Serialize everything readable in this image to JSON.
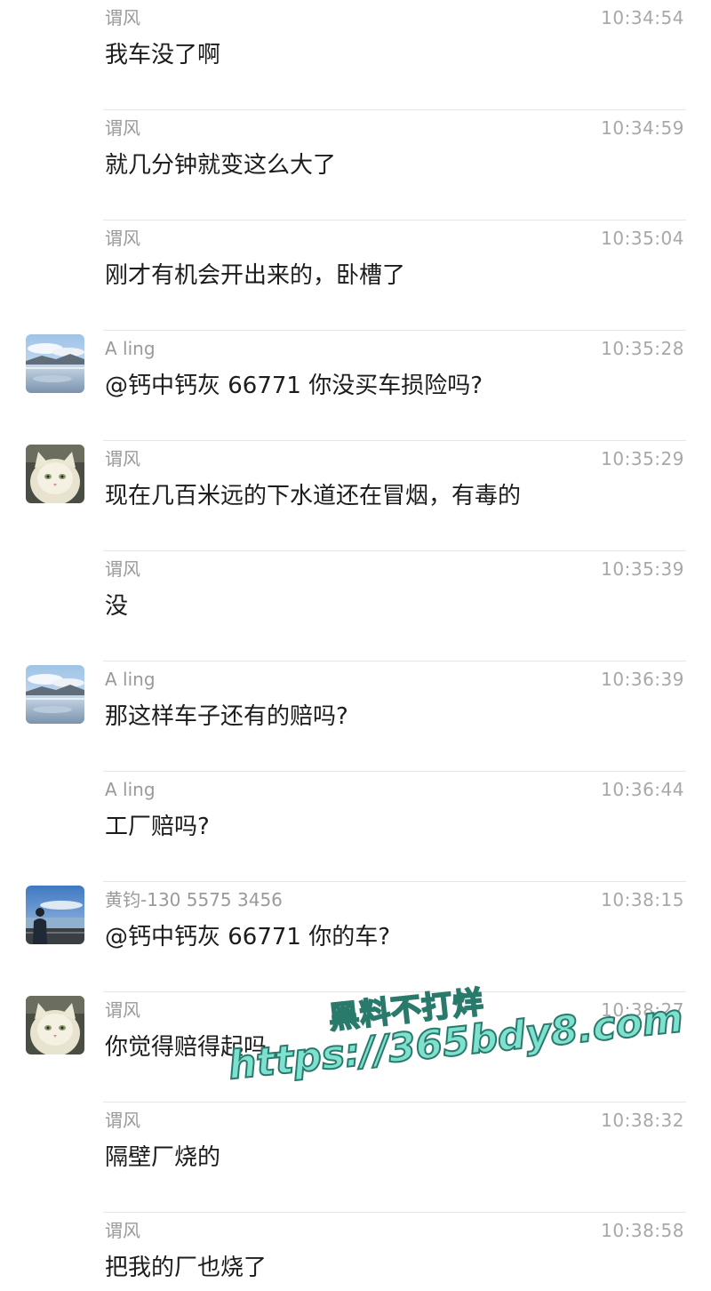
{
  "messages": [
    {
      "sender": "谓风",
      "time": "10:34:54",
      "text": "我车没了啊",
      "avatar": "none"
    },
    {
      "sender": "谓风",
      "time": "10:34:59",
      "text": "就几分钟就变这么大了",
      "avatar": "none"
    },
    {
      "sender": "谓风",
      "time": "10:35:04",
      "text": "刚才有机会开出来的，卧槽了",
      "avatar": "none"
    },
    {
      "sender": "A ling",
      "time": "10:35:28",
      "text": "@钙中钙灰 66771 你没买车损险吗?",
      "avatar": "lake-landscape"
    },
    {
      "sender": "谓风",
      "time": "10:35:29",
      "text": "现在几百米远的下水道还在冒烟，有毒的",
      "avatar": "white-cat"
    },
    {
      "sender": "谓风",
      "time": "10:35:39",
      "text": "没",
      "avatar": "none"
    },
    {
      "sender": "A ling",
      "time": "10:36:39",
      "text": "那这样车子还有的赔吗?",
      "avatar": "lake-landscape"
    },
    {
      "sender": "A ling",
      "time": "10:36:44",
      "text": "工厂赔吗?",
      "avatar": "none"
    },
    {
      "sender": "黄钧-130 5575 3456",
      "time": "10:38:15",
      "text": "@钙中钙灰 66771 你的车?",
      "avatar": "person-by-sea"
    },
    {
      "sender": "谓风",
      "time": "10:38:27",
      "text": "你觉得赔得起吗",
      "avatar": "white-cat"
    },
    {
      "sender": "谓风",
      "time": "10:38:32",
      "text": "隔壁厂烧的",
      "avatar": "none"
    },
    {
      "sender": "谓风",
      "time": "10:38:58",
      "text": "把我的厂也烧了",
      "avatar": "none"
    }
  ],
  "watermark": {
    "line1": "黑料不打烊",
    "line2": "https://365bdy8.com"
  },
  "colors": {
    "sender": "#9a9a9a",
    "time": "#a8a8a8",
    "text": "#1c1c1c",
    "divider": "#e6e6e6",
    "watermark_fill": "#7ee0cf",
    "watermark_stroke": "#2a7a6c"
  }
}
